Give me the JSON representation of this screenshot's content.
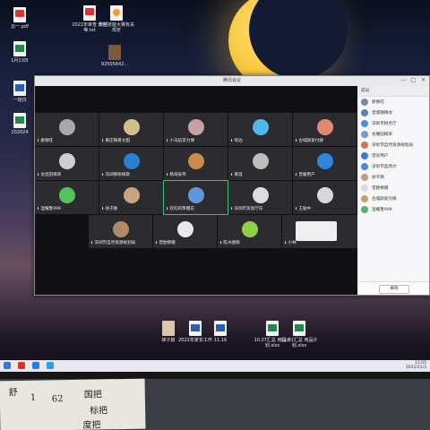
{
  "desktop": {
    "icons": [
      {
        "label": "云一.pdf",
        "kind": "pdf"
      },
      {
        "label": "1月13日",
        "kind": "xls"
      },
      {
        "label": "一班日",
        "kind": "doc"
      },
      {
        "label": "202024",
        "kind": "xls"
      },
      {
        "label": "2022年审查 计划等.txt",
        "kind": "pdf"
      },
      {
        "label": "数控技能大赛有关规定",
        "kind": "media"
      },
      {
        "label": "92505642...",
        "kind": "img"
      },
      {
        "label": "袜子篇",
        "kind": "img2"
      },
      {
        "label": "2022年家长工作",
        "kind": "doc"
      },
      {
        "label": "11.16",
        "kind": "doc"
      },
      {
        "label": "10.27汇总 用品计划.xlsx",
        "kind": "xls"
      },
      {
        "label": "11.01汇总 用品计划.xlsx",
        "kind": "xls"
      }
    ]
  },
  "meeting": {
    "title": "腾讯会议",
    "controls": {
      "minimize": "—",
      "maximize": "□",
      "close": "✕"
    },
    "tiles": [
      {
        "name": "康春旺",
        "color": "#a9a9a9"
      },
      {
        "name": "黄庄镇黄文甜",
        "color": "#d0c090"
      },
      {
        "name": "小马伍李力博",
        "color": "#c7a0a0"
      },
      {
        "name": "母泊",
        "color": "#4fb8e8"
      },
      {
        "name": "古城颜爱付媒",
        "color": "#e28a70"
      },
      {
        "name": "龙昌田梅荣",
        "color": "#cfcfcf"
      },
      {
        "name": "深圳镇张梅歌",
        "color": "#2a7fd4"
      },
      {
        "name": "杨海安伟",
        "color": "#c98b4a"
      },
      {
        "name": "黄温",
        "color": "#bdbdbd"
      },
      {
        "name": "曾媛用户",
        "color": "#2f86e0"
      },
      {
        "name": "温耀鲁999",
        "color": "#56c25a"
      },
      {
        "name": "徐子静",
        "color": "#c9a37c"
      },
      {
        "name": "欢钧风筝樱花",
        "color": "#5f98d8"
      },
      {
        "name": "深圳市贸易厅东",
        "color": "#dcdcdc"
      },
      {
        "name": "王聪中",
        "color": "#d8d8d8"
      },
      {
        "name": "深圳市自然资源规划局",
        "color": "#b08a68"
      },
      {
        "name": "曾欧柳娥",
        "color": "#e8e8e8"
      },
      {
        "name": "陈水德辉",
        "color": "#8fd047"
      },
      {
        "name": "小林",
        "color": "#efefef"
      }
    ],
    "side_panel": {
      "header": "成员",
      "members": [
        "廖春旺",
        "曾城锦镇龙",
        "深圳市财务厅",
        "龙曦田梅荣",
        "深圳市自然资源规划局",
        "曾诉用户",
        "深圳市监场力",
        "徐子静",
        "曾欧柳娥",
        "古城颜爱付媒",
        "温耀鲁999"
      ],
      "button": "解除"
    }
  },
  "taskbar": {
    "time": "11:05",
    "date": "2022/11/3"
  },
  "paper_note": {
    "lines": [
      "舒",
      "1",
      "62",
      "国把",
      "标把",
      "度把"
    ]
  }
}
